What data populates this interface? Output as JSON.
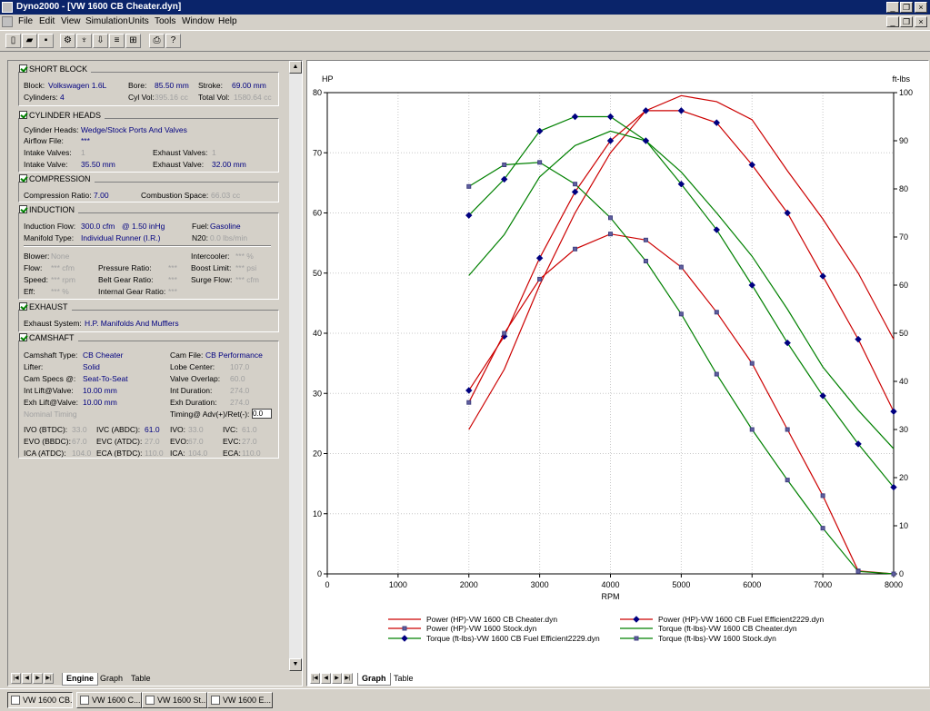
{
  "window": {
    "title": "Dyno2000 - [VW 1600 CB Cheater.dyn]"
  },
  "menu": [
    "File",
    "Edit",
    "View",
    "Simulation",
    "Units",
    "Tools",
    "Window",
    "Help"
  ],
  "short_block": {
    "header": "SHORT BLOCK",
    "block_label": "Block:",
    "block": "Volkswagen 1.6L",
    "bore_label": "Bore:",
    "bore": "85.50 mm",
    "stroke_label": "Stroke:",
    "stroke": "69.00 mm",
    "cylinders_label": "Cylinders:",
    "cylinders": "4",
    "cylvol_label": "Cyl Vol:",
    "cylvol": "395.16 cc",
    "totalvol_label": "Total Vol:",
    "totalvol": "1580.64 cc"
  },
  "cylinder_heads": {
    "header": "CYLINDER HEADS",
    "heads_label": "Cylinder Heads:",
    "heads": "Wedge/Stock Ports And Valves",
    "airflow_label": "Airflow File:",
    "airflow": "***",
    "intake_valves_label": "Intake Valves:",
    "intake_valves": "1",
    "exhaust_valves_label": "Exhaust Valves:",
    "exhaust_valves": "1",
    "intake_valve_label": "Intake Valve:",
    "intake_valve": "35.50 mm",
    "exhaust_valve_label": "Exhaust Valve:",
    "exhaust_valve": "32.00 mm"
  },
  "compression": {
    "header": "COMPRESSION",
    "ratio_label": "Compression Ratio:",
    "ratio": "7.00",
    "space_label": "Combustion Space:",
    "space": "66.03 cc"
  },
  "induction": {
    "header": "INDUCTION",
    "flow_label": "Induction Flow:",
    "flow": "300.0 cfm",
    "flow_at": "@ 1.50 inHg",
    "fuel_label": "Fuel:",
    "fuel": "Gasoline",
    "manifold_label": "Manifold Type:",
    "manifold": "Individual Runner (I.R.)",
    "n20_label": "N20:",
    "n20": "0.0 lbs/min",
    "blower_label": "Blower:",
    "blower": "None",
    "intercooler_label": "Intercooler:",
    "intercooler": "*** %",
    "bflow_label": "Flow:",
    "bflow": "*** cfm",
    "pressure_label": "Pressure Ratio:",
    "pressure": "***",
    "boost_label": "Boost Limit:",
    "boost": "*** psi",
    "speed_label": "Speed:",
    "speed": "*** rpm",
    "belt_label": "Belt Gear Ratio:",
    "belt": "***",
    "surge_label": "Surge Flow:",
    "surge": "*** cfm",
    "eff_label": "Eff:",
    "eff": "*** %",
    "internal_label": "Internal Gear Ratio:",
    "internal": "***"
  },
  "exhaust": {
    "header": "EXHAUST",
    "system_label": "Exhaust System:",
    "system": "H.P. Manifolds And Mufflers"
  },
  "camshaft": {
    "header": "CAMSHAFT",
    "type_label": "Camshaft Type:",
    "type": "CB Cheater",
    "camfile_label": "Cam File:",
    "camfile": "CB Performance",
    "lifter_label": "Lifter:",
    "lifter": "Solid",
    "lobe_label": "Lobe Center:",
    "lobe": "107.0",
    "specs_label": "Cam Specs @:",
    "specs": "Seat-To-Seat",
    "overlap_label": "Valve Overlap:",
    "overlap": "60.0",
    "intlift_label": "Int Lift@Valve:",
    "intlift": "10.00 mm",
    "intdur_label": "Int Duration:",
    "intdur": "274.0",
    "exhlift_label": "Exh Lift@Valve:",
    "exhlift": "10.00 mm",
    "exhdur_label": "Exh Duration:",
    "exhdur": "274.0",
    "nominal_label": "Nominal Timing",
    "timing_label": "Timing@ Adv(+)/Ret(-):",
    "timing": "0.0",
    "ivo1_label": "IVO (BTDC):",
    "ivo1": "33.0",
    "ivc1_label": "IVC (ABDC):",
    "ivc1": "61.0",
    "ivo2_label": "IVO:",
    "ivo2": "33.0",
    "ivc2_label": "IVC:",
    "ivc2": "61.0",
    "evo1_label": "EVO (BBDC):",
    "evo1": "67.0",
    "evc1_label": "EVC (ATDC):",
    "evc1": "27.0",
    "evo2_label": "EVO:",
    "evo2": "67.0",
    "evc2_label": "EVC:",
    "evc2": "27.0",
    "ica1_label": "ICA (ATDC):",
    "ica1": "104.0",
    "eca1_label": "ECA (BTDC):",
    "eca1": "110.0",
    "ica2_label": "ICA:",
    "ica2": "104.0",
    "eca2_label": "ECA:",
    "eca2": "110.0"
  },
  "left_tabs": [
    "Engine",
    "Graph",
    "Table"
  ],
  "right_tabs": [
    "Graph",
    "Table"
  ],
  "taskbar": [
    "VW 1600 CB...",
    "VW 1600 C...",
    "VW 1600 St...",
    "VW 1600 E..."
  ],
  "colors": {
    "red": "#cc0000",
    "green": "#008000"
  },
  "chart_data": {
    "type": "line",
    "xlabel": "RPM",
    "ylabel_left": "HP",
    "ylabel_right": "ft-lbs",
    "xlim": [
      0,
      8000
    ],
    "ylim_left": [
      0,
      80
    ],
    "ylim_right": [
      0,
      100
    ],
    "xticks": [
      0,
      1000,
      2000,
      3000,
      4000,
      5000,
      6000,
      7000,
      8000
    ],
    "yticks_left": [
      0,
      10,
      20,
      30,
      40,
      50,
      60,
      70,
      80
    ],
    "yticks_right": [
      0,
      10,
      20,
      30,
      40,
      50,
      60,
      70,
      80,
      90,
      100
    ],
    "grid": true,
    "legend_placement": "bottom",
    "x": [
      2000,
      2500,
      3000,
      3500,
      4000,
      4500,
      5000,
      5500,
      6000,
      6500,
      7000,
      7500,
      8000
    ],
    "series": [
      {
        "name": "Power (HP)-VW 1600 CB Cheater.dyn",
        "axis": "left",
        "color": "#cc0000",
        "marker": "none",
        "values": [
          24,
          34,
          48,
          60,
          70,
          77,
          79.5,
          78.5,
          75.5,
          67,
          59,
          50,
          39
        ]
      },
      {
        "name": "Power (HP)-VW 1600 CB Fuel Efficient2229.dyn",
        "axis": "left",
        "color": "#cc0000",
        "marker": "diamond",
        "values": [
          30.5,
          39.5,
          52.5,
          63.5,
          72,
          77,
          77,
          75,
          68,
          60,
          49.5,
          39,
          27
        ]
      },
      {
        "name": "Power (HP)-VW 1600 Stock.dyn",
        "axis": "left",
        "color": "#cc0000",
        "marker": "square",
        "values": [
          28.5,
          40,
          49,
          54,
          56.5,
          55.5,
          51,
          43.5,
          35,
          24,
          13,
          0.5,
          0
        ]
      },
      {
        "name": "Torque (ft-lbs)-VW 1600 CB Cheater.dyn",
        "axis": "right",
        "color": "#008000",
        "marker": "none",
        "values": [
          62,
          70.5,
          82.5,
          89,
          92,
          90,
          83.5,
          75,
          66,
          55,
          43,
          34,
          26
        ]
      },
      {
        "name": "Torque (ft-lbs)-VW 1600 CB Fuel Efficient2229.dyn",
        "axis": "right",
        "color": "#008000",
        "marker": "diamond",
        "values": [
          74.5,
          82,
          92,
          95,
          95,
          90,
          81,
          71.5,
          60,
          48,
          37,
          27,
          18
        ]
      },
      {
        "name": "Torque (ft-lbs)-VW 1600 Stock.dyn",
        "axis": "right",
        "color": "#008000",
        "marker": "square",
        "values": [
          80.5,
          85,
          85.5,
          81,
          74,
          65,
          54,
          41.5,
          30,
          19.5,
          9.5,
          0.5,
          0
        ]
      }
    ]
  }
}
